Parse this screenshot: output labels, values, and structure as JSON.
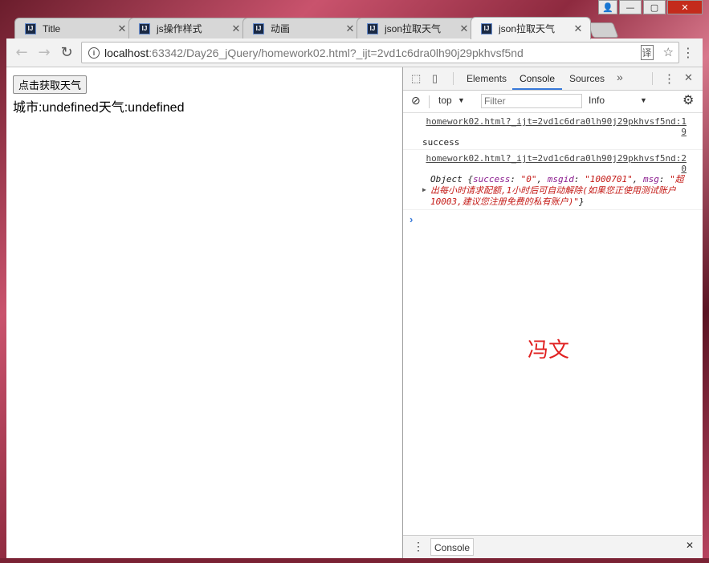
{
  "window_controls": {
    "user": "👤",
    "minimize": "—",
    "maximize": "▢",
    "close": "✕"
  },
  "tabs": [
    {
      "label": "Title",
      "favicon": "IJ",
      "close": "✕"
    },
    {
      "label": "js操作样式",
      "favicon": "IJ",
      "close": "✕"
    },
    {
      "label": "动画",
      "favicon": "IJ",
      "close": "✕"
    },
    {
      "label": "json拉取天气",
      "favicon": "IJ",
      "close": "✕"
    },
    {
      "label": "json拉取天气",
      "favicon": "IJ",
      "close": "✕"
    }
  ],
  "toolbar": {
    "back": "←",
    "forward": "→",
    "reload": "↻",
    "url_host": "localhost",
    "url_path": ":63342/Day26_jQuery/homework02.html?_ijt=2vd1c6dra0lh90j29pkhvsf5nd",
    "info": "i",
    "translate": "译",
    "bookmark": "☆",
    "menu": "⋮"
  },
  "page": {
    "button_label": "点击获取天气",
    "weather_text": "城市:undefined天气:undefined"
  },
  "devtools": {
    "inspect_icon": "⬚",
    "device_icon": "▯",
    "tabs": [
      "Elements",
      "Console",
      "Sources"
    ],
    "more_tabs": "»",
    "menu": "⋮",
    "close": "✕",
    "clear_icon": "⊘",
    "context": "top",
    "context_caret": "▼",
    "filter_placeholder": "Filter",
    "level": "Info",
    "level_caret": "▼",
    "settings_icon": "⚙",
    "messages": [
      {
        "source": "homework02.html?_ijt=2vd1c6dra0lh90j29pkhvsf5nd:19",
        "text": "success"
      },
      {
        "source": "homework02.html?_ijt=2vd1c6dra0lh90j29pkhvsf5nd:20",
        "object_prefix": "Object {",
        "key1": "success",
        "val1": "\"0\"",
        "key2": "msgid",
        "val2": "\"1000701\"",
        "key3": "msg",
        "val3": "\"超出每小时请求配额,1小时后可自动解除(如果您正使用测试账户10003,建议您注册免费的私有账户)\"",
        "object_suffix": "}"
      }
    ],
    "prompt": "›",
    "watermark": "冯文",
    "drawer_menu": "⋮",
    "drawer_tab": "Console",
    "drawer_close": "✕"
  }
}
